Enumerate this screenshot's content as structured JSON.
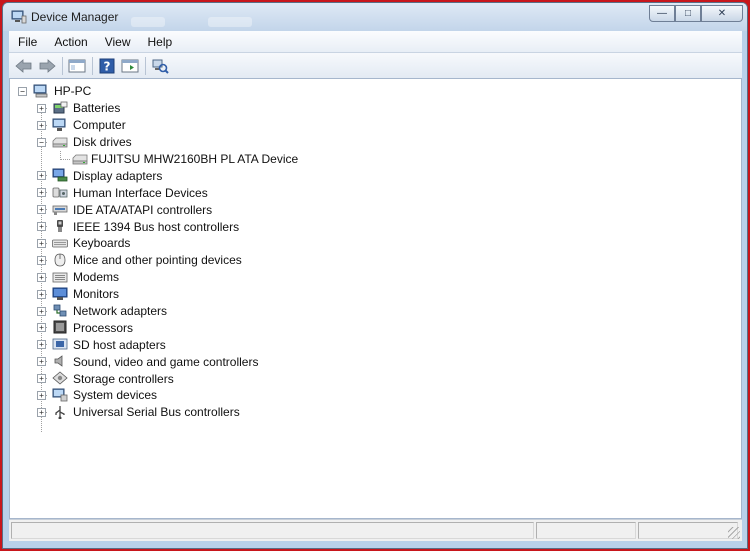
{
  "window": {
    "title": "Device Manager",
    "minimize_glyph": "—",
    "maximize_glyph": "□",
    "close_glyph": "✕"
  },
  "menu": [
    "File",
    "Action",
    "View",
    "Help"
  ],
  "toolbar": {
    "buttons": [
      "back-arrow-icon",
      "forward-arrow-icon",
      "console-tree-icon",
      "help-icon",
      "properties-icon",
      "scan-hardware-icon"
    ],
    "help_glyph": "?"
  },
  "tree": {
    "root": {
      "label": "HP-PC",
      "icon": "computer-icon",
      "expanded": true
    },
    "items": [
      {
        "label": "Batteries",
        "icon": "battery-icon",
        "expanded": false,
        "children": []
      },
      {
        "label": "Computer",
        "icon": "computer-icon",
        "expanded": false,
        "children": []
      },
      {
        "label": "Disk drives",
        "icon": "disk-drive-icon",
        "expanded": true,
        "children": [
          {
            "label": "FUJITSU MHW2160BH PL ATA Device",
            "icon": "disk-drive-icon"
          }
        ]
      },
      {
        "label": "Display adapters",
        "icon": "display-adapter-icon",
        "expanded": false,
        "children": []
      },
      {
        "label": "Human Interface Devices",
        "icon": "hid-icon",
        "expanded": false,
        "children": []
      },
      {
        "label": "IDE ATA/ATAPI controllers",
        "icon": "ide-controller-icon",
        "expanded": false,
        "children": []
      },
      {
        "label": "IEEE 1394 Bus host controllers",
        "icon": "ieee1394-icon",
        "expanded": false,
        "children": []
      },
      {
        "label": "Keyboards",
        "icon": "keyboard-icon",
        "expanded": false,
        "children": []
      },
      {
        "label": "Mice and other pointing devices",
        "icon": "mouse-icon",
        "expanded": false,
        "children": []
      },
      {
        "label": "Modems",
        "icon": "modem-icon",
        "expanded": false,
        "children": []
      },
      {
        "label": "Monitors",
        "icon": "monitor-icon",
        "expanded": false,
        "children": []
      },
      {
        "label": "Network adapters",
        "icon": "network-adapter-icon",
        "expanded": false,
        "children": []
      },
      {
        "label": "Processors",
        "icon": "processor-icon",
        "expanded": false,
        "children": []
      },
      {
        "label": "SD host adapters",
        "icon": "sd-card-icon",
        "expanded": false,
        "children": []
      },
      {
        "label": "Sound, video and game controllers",
        "icon": "speaker-icon",
        "expanded": false,
        "children": []
      },
      {
        "label": "Storage controllers",
        "icon": "storage-controller-icon",
        "expanded": false,
        "children": []
      },
      {
        "label": "System devices",
        "icon": "system-devices-icon",
        "expanded": false,
        "children": []
      },
      {
        "label": "Universal Serial Bus controllers",
        "icon": "usb-icon",
        "expanded": false,
        "children": []
      }
    ]
  },
  "colors": {
    "desktop_border": "#c8161c",
    "window_frame": "#b9d1ea",
    "tree_background": "#ffffff"
  }
}
